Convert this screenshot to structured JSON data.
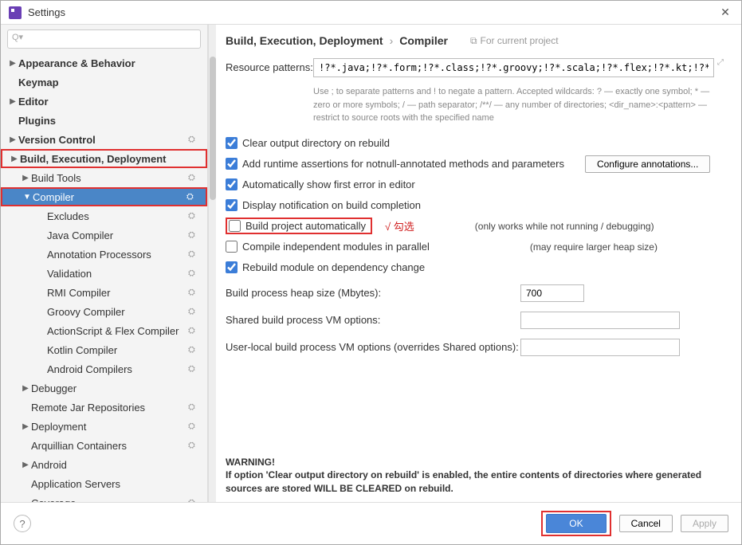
{
  "window": {
    "title": "Settings"
  },
  "search": {
    "placeholder": ""
  },
  "sidebar": {
    "items": [
      {
        "label": "Appearance & Behavior",
        "bold": true,
        "arrow": "▶",
        "indent": 0,
        "gear": false,
        "selected": false,
        "redbox": false
      },
      {
        "label": "Keymap",
        "bold": true,
        "arrow": "",
        "indent": 0,
        "gear": false,
        "selected": false,
        "redbox": false
      },
      {
        "label": "Editor",
        "bold": true,
        "arrow": "▶",
        "indent": 0,
        "gear": false,
        "selected": false,
        "redbox": false
      },
      {
        "label": "Plugins",
        "bold": true,
        "arrow": "",
        "indent": 0,
        "gear": false,
        "selected": false,
        "redbox": false
      },
      {
        "label": "Version Control",
        "bold": true,
        "arrow": "▶",
        "indent": 0,
        "gear": true,
        "selected": false,
        "redbox": false
      },
      {
        "label": "Build, Execution, Deployment",
        "bold": true,
        "arrow": "▶",
        "indent": 0,
        "gear": false,
        "selected": false,
        "redbox": true
      },
      {
        "label": "Build Tools",
        "bold": false,
        "arrow": "▶",
        "indent": 1,
        "gear": true,
        "selected": false,
        "redbox": false
      },
      {
        "label": "Compiler",
        "bold": false,
        "arrow": "▼",
        "indent": 1,
        "gear": true,
        "selected": true,
        "redbox": true
      },
      {
        "label": "Excludes",
        "bold": false,
        "arrow": "",
        "indent": 2,
        "gear": true,
        "selected": false,
        "redbox": false
      },
      {
        "label": "Java Compiler",
        "bold": false,
        "arrow": "",
        "indent": 2,
        "gear": true,
        "selected": false,
        "redbox": false
      },
      {
        "label": "Annotation Processors",
        "bold": false,
        "arrow": "",
        "indent": 2,
        "gear": true,
        "selected": false,
        "redbox": false
      },
      {
        "label": "Validation",
        "bold": false,
        "arrow": "",
        "indent": 2,
        "gear": true,
        "selected": false,
        "redbox": false
      },
      {
        "label": "RMI Compiler",
        "bold": false,
        "arrow": "",
        "indent": 2,
        "gear": true,
        "selected": false,
        "redbox": false
      },
      {
        "label": "Groovy Compiler",
        "bold": false,
        "arrow": "",
        "indent": 2,
        "gear": true,
        "selected": false,
        "redbox": false
      },
      {
        "label": "ActionScript & Flex Compiler",
        "bold": false,
        "arrow": "",
        "indent": 2,
        "gear": true,
        "selected": false,
        "redbox": false
      },
      {
        "label": "Kotlin Compiler",
        "bold": false,
        "arrow": "",
        "indent": 2,
        "gear": true,
        "selected": false,
        "redbox": false
      },
      {
        "label": "Android Compilers",
        "bold": false,
        "arrow": "",
        "indent": 2,
        "gear": true,
        "selected": false,
        "redbox": false
      },
      {
        "label": "Debugger",
        "bold": false,
        "arrow": "▶",
        "indent": 1,
        "gear": false,
        "selected": false,
        "redbox": false
      },
      {
        "label": "Remote Jar Repositories",
        "bold": false,
        "arrow": "",
        "indent": 1,
        "gear": true,
        "selected": false,
        "redbox": false
      },
      {
        "label": "Deployment",
        "bold": false,
        "arrow": "▶",
        "indent": 1,
        "gear": true,
        "selected": false,
        "redbox": false
      },
      {
        "label": "Arquillian Containers",
        "bold": false,
        "arrow": "",
        "indent": 1,
        "gear": true,
        "selected": false,
        "redbox": false
      },
      {
        "label": "Android",
        "bold": false,
        "arrow": "▶",
        "indent": 1,
        "gear": false,
        "selected": false,
        "redbox": false
      },
      {
        "label": "Application Servers",
        "bold": false,
        "arrow": "",
        "indent": 1,
        "gear": false,
        "selected": false,
        "redbox": false
      },
      {
        "label": "Coverage",
        "bold": false,
        "arrow": "",
        "indent": 1,
        "gear": true,
        "selected": false,
        "redbox": false
      }
    ]
  },
  "breadcrumb": {
    "parent": "Build, Execution, Deployment",
    "sep": "›",
    "current": "Compiler",
    "hint": "For current project"
  },
  "patterns": {
    "label": "Resource patterns:",
    "value": "!?*.java;!?*.form;!?*.class;!?*.groovy;!?*.scala;!?*.flex;!?*.kt;!?*.clj;!?*.aj",
    "help": "Use ; to separate patterns and ! to negate a pattern. Accepted wildcards: ? — exactly one symbol; * — zero or more symbols; / — path separator; /**/ — any number of directories;  <dir_name>:<pattern> — restrict to source roots with the specified name"
  },
  "checks": {
    "clear": {
      "label": "Clear output directory on rebuild",
      "checked": true
    },
    "assertions": {
      "label": "Add runtime assertions for notnull-annotated methods and parameters",
      "checked": true,
      "btn": "Configure annotations..."
    },
    "firsterror": {
      "label": "Automatically show first error in editor",
      "checked": true
    },
    "notify": {
      "label": "Display notification on build completion",
      "checked": true
    },
    "auto": {
      "label": "Build project automatically",
      "checked": false,
      "note": "(only works while not running / debugging)",
      "annot": "√ 勾选"
    },
    "parallel": {
      "label": "Compile independent modules in parallel",
      "checked": false,
      "note": "(may require larger heap size)"
    },
    "rebuild": {
      "label": "Rebuild module on dependency change",
      "checked": true
    }
  },
  "fields": {
    "heap": {
      "label": "Build process heap size (Mbytes):",
      "value": "700"
    },
    "shared": {
      "label": "Shared build process VM options:",
      "value": ""
    },
    "user": {
      "label": "User-local build process VM options (overrides Shared options):",
      "value": ""
    }
  },
  "warning": {
    "title": "WARNING!",
    "text": "If option 'Clear output directory on rebuild' is enabled, the entire contents of directories where generated sources are stored WILL BE CLEARED on rebuild."
  },
  "footer": {
    "ok": "OK",
    "cancel": "Cancel",
    "apply": "Apply"
  }
}
